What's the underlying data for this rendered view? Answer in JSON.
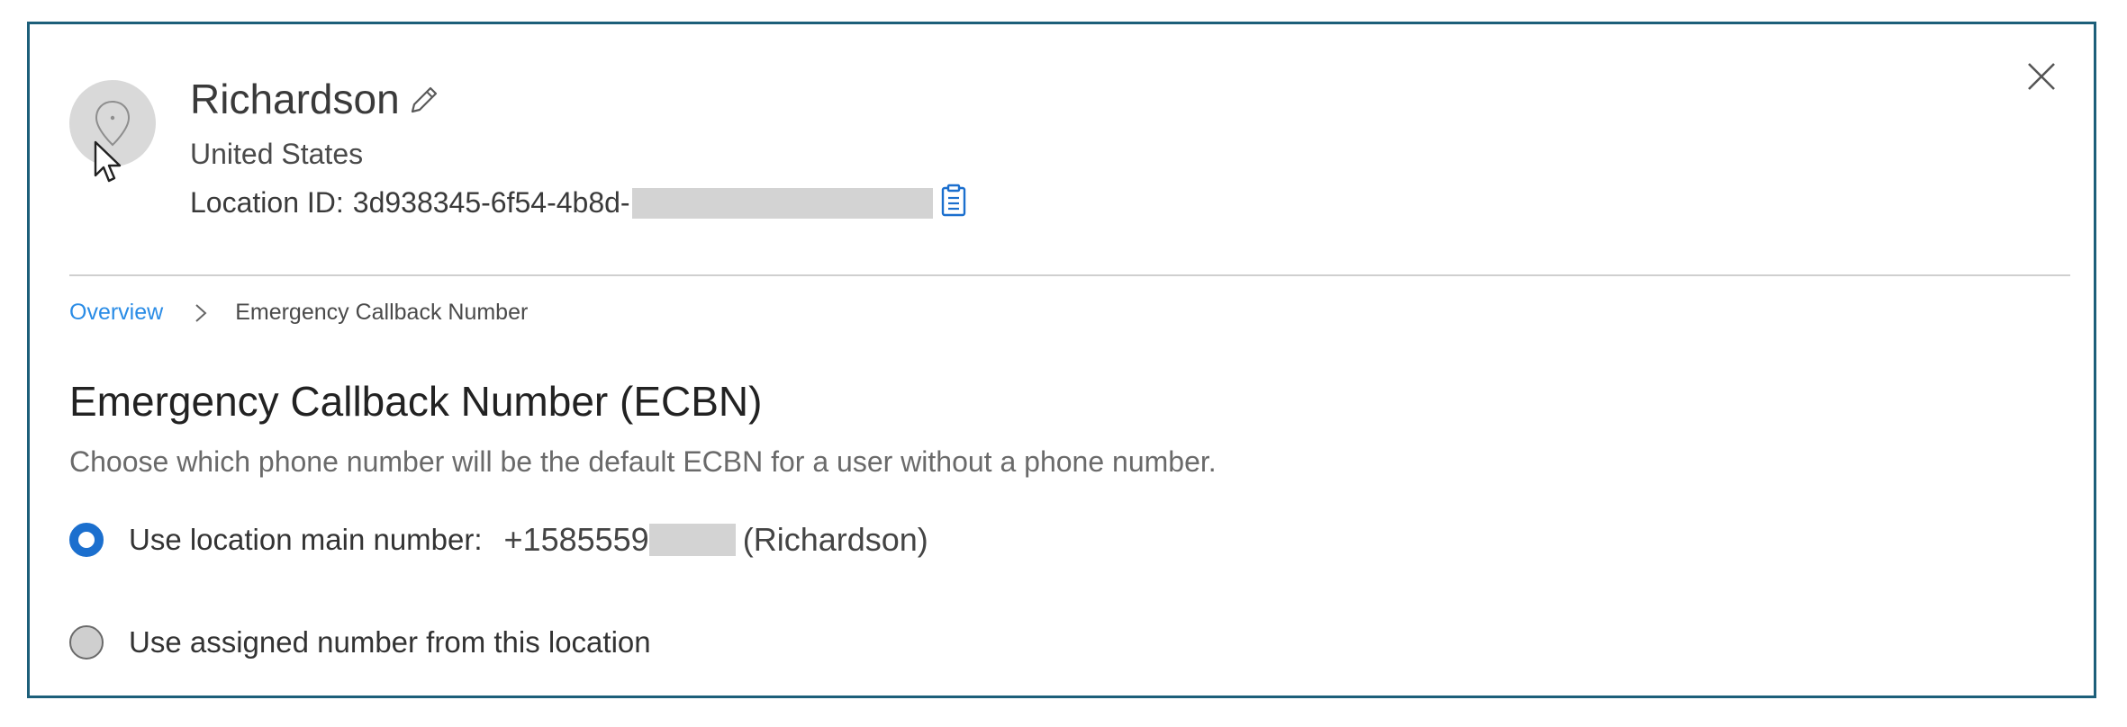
{
  "header": {
    "title": "Richardson",
    "country": "United States",
    "location_id_label": "Location ID:",
    "location_id_value": "3d938345-6f54-4b8d-"
  },
  "icons": {
    "avatar": "location-pin-icon",
    "edit": "pencil-icon",
    "copy": "clipboard-icon",
    "close": "close-icon",
    "breadcrumb_separator": "chevron-right-icon"
  },
  "breadcrumb": {
    "link": "Overview",
    "current": "Emergency Callback Number"
  },
  "section": {
    "title": "Emergency Callback Number (ECBN)",
    "description": "Choose which phone number will be the default ECBN for a user without a phone number."
  },
  "options": [
    {
      "label": "Use location main number:",
      "number_prefix": "+1585559",
      "location": "(Richardson)",
      "selected": true
    },
    {
      "label": "Use assigned number from this location",
      "selected": false
    }
  ],
  "colors": {
    "border": "#1d5f7a",
    "link": "#2a8ce6",
    "radio_selected": "#1b6fce"
  }
}
